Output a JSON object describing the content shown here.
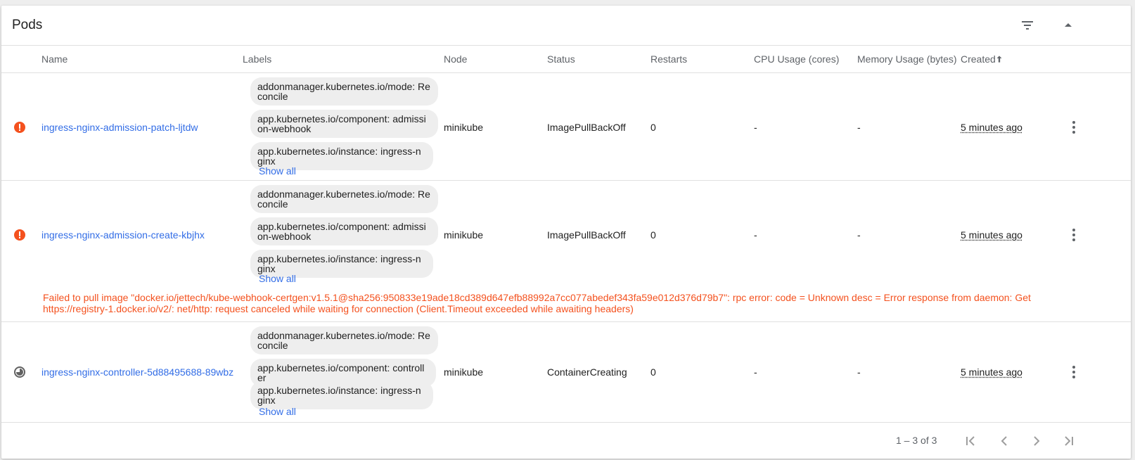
{
  "card": {
    "title": "Pods"
  },
  "columns": {
    "name": "Name",
    "labels": "Labels",
    "node": "Node",
    "status": "Status",
    "restarts": "Restarts",
    "cpu": "CPU Usage (cores)",
    "memory": "Memory Usage (bytes)",
    "created": "Created"
  },
  "rows": [
    {
      "name": "ingress-nginx-admission-patch-ljtdw",
      "labels": [
        "addonmanager.kubernetes.io/mode: Reconcile",
        "app.kubernetes.io/component: admission-webhook",
        "app.kubernetes.io/instance: ingress-nginx"
      ],
      "show_all": "Show all",
      "node": "minikube",
      "status": "ImagePullBackOff",
      "restarts": "0",
      "cpu": "-",
      "memory": "-",
      "created": "5 minutes ago",
      "state_icon": "error-icon"
    },
    {
      "name": "ingress-nginx-admission-create-kbjhx",
      "labels": [
        "addonmanager.kubernetes.io/mode: Reconcile",
        "app.kubernetes.io/component: admission-webhook",
        "app.kubernetes.io/instance: ingress-nginx"
      ],
      "show_all": "Show all",
      "node": "minikube",
      "status": "ImagePullBackOff",
      "restarts": "0",
      "cpu": "-",
      "memory": "-",
      "created": "5 minutes ago",
      "state_icon": "error-icon",
      "error": "Failed to pull image \"docker.io/jettech/kube-webhook-certgen:v1.5.1@sha256:950833e19ade18cd389d647efb88992a7cc077abedef343fa59e012d376d79b7\": rpc error: code = Unknown desc = Error response from daemon: Get https://registry-1.docker.io/v2/: net/http: request canceled while waiting for connection (Client.Timeout exceeded while awaiting headers)"
    },
    {
      "name": "ingress-nginx-controller-5d88495688-89wbz",
      "labels": [
        "addonmanager.kubernetes.io/mode: Reconcile",
        "app.kubernetes.io/component: controller",
        "app.kubernetes.io/instance: ingress-nginx"
      ],
      "show_all": "Show all",
      "node": "minikube",
      "status": "ContainerCreating",
      "restarts": "0",
      "cpu": "-",
      "memory": "-",
      "created": "5 minutes ago",
      "state_icon": "pending-icon"
    }
  ],
  "pagination": {
    "range": "1 – 3 of 3"
  },
  "colors": {
    "link": "#326de6",
    "error": "#f4511e",
    "chip": "#eeeeee"
  }
}
